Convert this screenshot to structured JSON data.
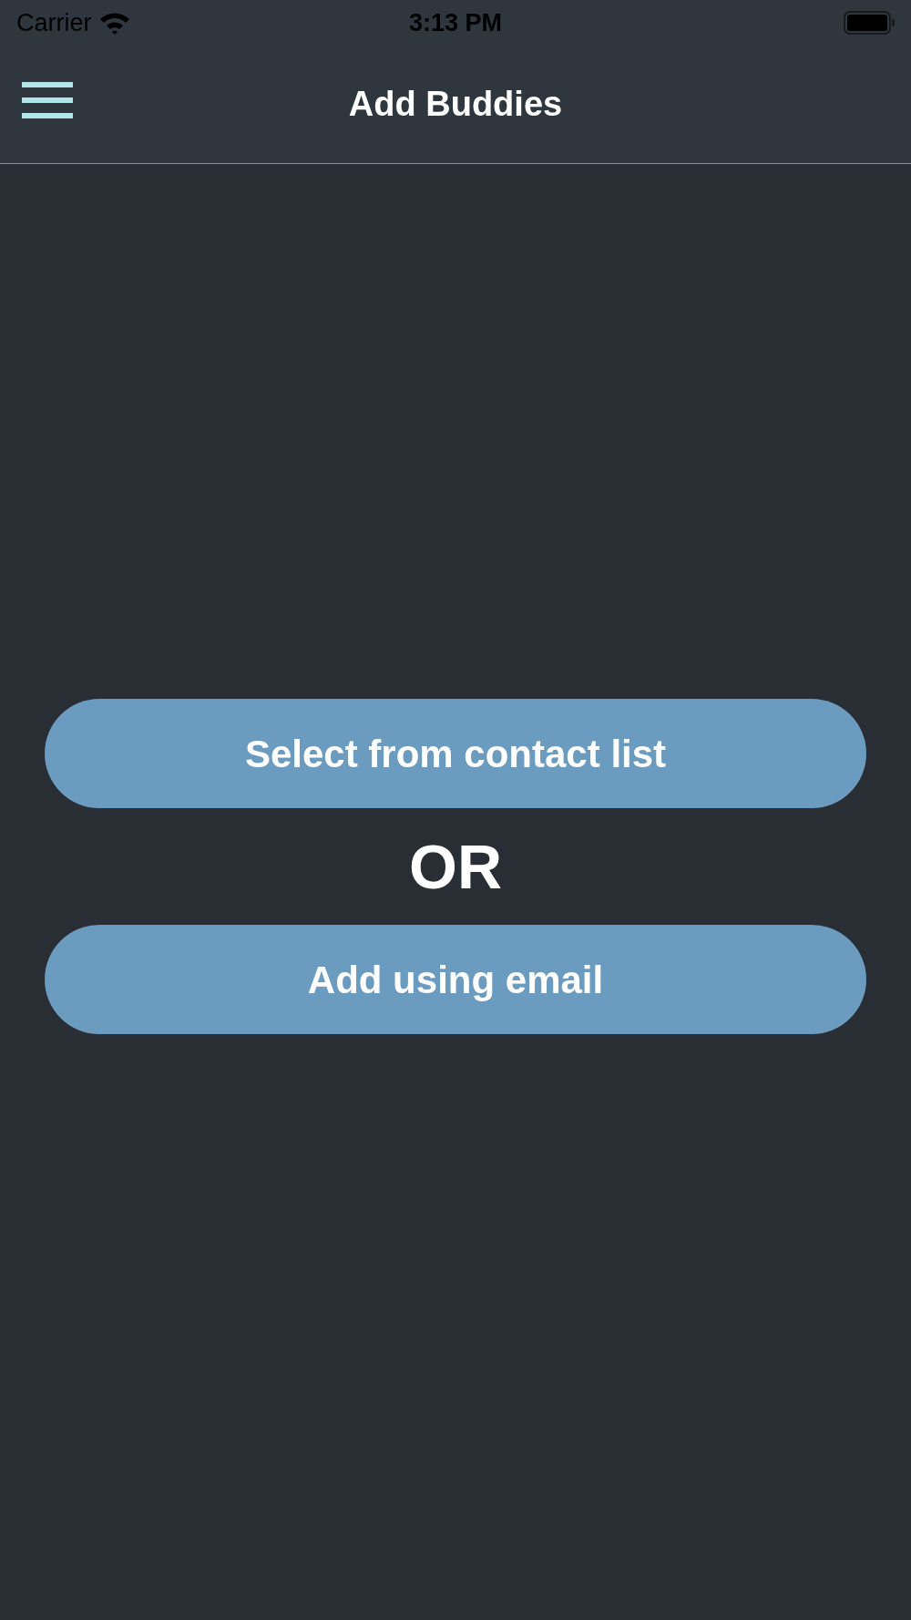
{
  "status_bar": {
    "carrier": "Carrier",
    "time": "3:13 PM"
  },
  "nav_bar": {
    "title": "Add Buddies"
  },
  "buttons": [
    {
      "label": "Select from contact list"
    },
    {
      "label": "Add using email"
    }
  ],
  "separator": "OR"
}
